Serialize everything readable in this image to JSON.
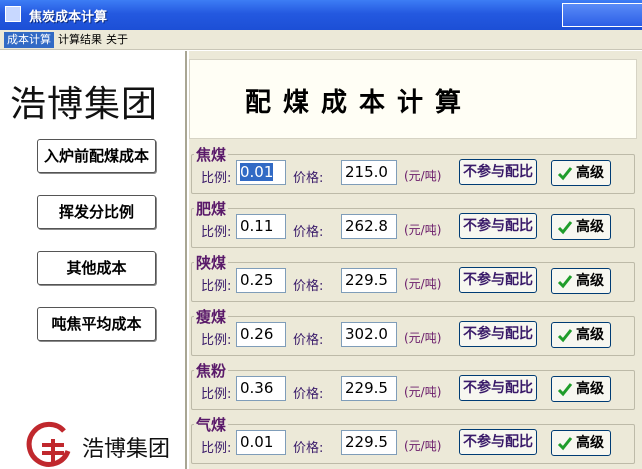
{
  "window": {
    "title": "焦炭成本计算"
  },
  "menu": [
    {
      "label": "成本计算",
      "active": true
    },
    {
      "label": "计算结果",
      "active": false
    },
    {
      "label": "关于",
      "active": false
    }
  ],
  "sidebar": {
    "logo_text": "浩博集团",
    "buttons": [
      "入炉前配煤成本",
      "挥发分比例",
      "其他成本",
      "吨焦平均成本"
    ],
    "logo_bottom_text": "浩博集团"
  },
  "main": {
    "header_title": "配煤成本计算",
    "ratio_label": "比例:",
    "price_label": "价格:",
    "unit": "(元/吨)",
    "exclude_label": "不参与配比",
    "advanced_label": "高级",
    "coals": [
      {
        "name": "焦煤",
        "ratio": "0.01",
        "price": "215.0"
      },
      {
        "name": "肥煤",
        "ratio": "0.11",
        "price": "262.8"
      },
      {
        "name": "陕煤",
        "ratio": "0.25",
        "price": "229.5"
      },
      {
        "name": "瘦煤",
        "ratio": "0.26",
        "price": "302.0"
      },
      {
        "name": "焦粉",
        "ratio": "0.36",
        "price": "229.5"
      },
      {
        "name": "气煤",
        "ratio": "0.01",
        "price": "229.5"
      }
    ]
  },
  "colors": {
    "titlebar": "#2459e0",
    "label": "#5a1a6a",
    "check": "#1f9d2a"
  }
}
